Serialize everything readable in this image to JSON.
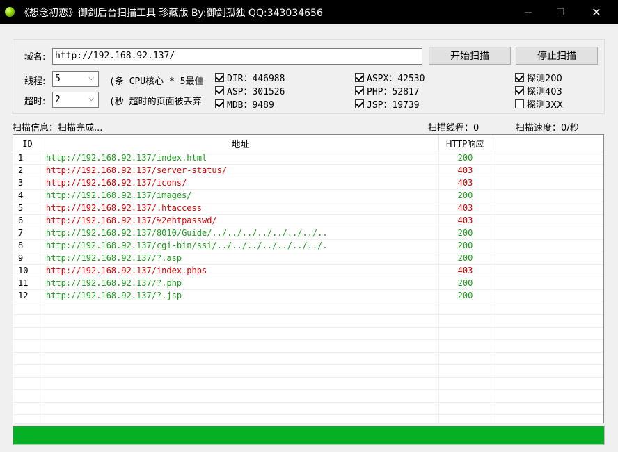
{
  "window": {
    "title": "《想念初恋》御剑后台扫描工具 珍藏版 By:御剑孤独 QQ:343034656",
    "icons": {
      "app": "green-ball-icon",
      "minimize": "minimize-icon",
      "maximize": "maximize-icon",
      "close": "close-icon"
    },
    "close_glyph": "✕"
  },
  "settings": {
    "domain_label": "域名:",
    "domain_value": "http://192.168.92.137/",
    "start_button": "开始扫描",
    "stop_button": "停止扫描",
    "threads_label": "线程:",
    "threads_value": "5",
    "threads_hint": "(条 CPU核心 * 5最佳",
    "timeout_label": "超时:",
    "timeout_value": "2",
    "timeout_hint": "(秒 超时的页面被丢弃",
    "dropdown_arrow": "⌵",
    "dictionaries": [
      {
        "label": "DIR：446988",
        "checked": true
      },
      {
        "label": "ASP：301526",
        "checked": true
      },
      {
        "label": "MDB：9489",
        "checked": true
      },
      {
        "label": "ASPX：42530",
        "checked": true
      },
      {
        "label": "PHP：52817",
        "checked": true
      },
      {
        "label": "JSP：19739",
        "checked": true
      }
    ],
    "probes": [
      {
        "label": "探测200",
        "checked": true
      },
      {
        "label": "探测403",
        "checked": true
      },
      {
        "label": "探测3XX",
        "checked": false
      }
    ]
  },
  "status": {
    "info": "扫描信息：扫描完成...",
    "threads": "扫描线程：0",
    "speed": "扫描速度：0/秒"
  },
  "results": {
    "columns": {
      "id": "ID",
      "address": "地址",
      "http": "HTTP响应"
    },
    "rows": [
      {
        "id": "1",
        "url": "http://192.168.92.137/index.html",
        "code": "200"
      },
      {
        "id": "2",
        "url": "http://192.168.92.137/server-status/",
        "code": "403"
      },
      {
        "id": "3",
        "url": "http://192.168.92.137/icons/",
        "code": "403"
      },
      {
        "id": "4",
        "url": "http://192.168.92.137/images/",
        "code": "200"
      },
      {
        "id": "5",
        "url": "http://192.168.92.137/.htaccess",
        "code": "403"
      },
      {
        "id": "6",
        "url": "http://192.168.92.137/%2ehtpasswd/",
        "code": "403"
      },
      {
        "id": "7",
        "url": "http://192.168.92.137/8010/Guide/../../../../../../../..",
        "code": "200"
      },
      {
        "id": "8",
        "url": "http://192.168.92.137/cgi-bin/ssi/../../../../../../../.",
        "code": "200"
      },
      {
        "id": "9",
        "url": "http://192.168.92.137/?.asp",
        "code": "200"
      },
      {
        "id": "10",
        "url": "http://192.168.92.137/index.phps",
        "code": "403"
      },
      {
        "id": "11",
        "url": "http://192.168.92.137/?.php",
        "code": "200"
      },
      {
        "id": "12",
        "url": "http://192.168.92.137/?.jsp",
        "code": "200"
      }
    ],
    "empty_rows": 10
  },
  "progress": {
    "fraction": 1.0,
    "color": "#06b025"
  },
  "colors": {
    "status_200": "#1aa11a",
    "status_403": "#e00000"
  }
}
